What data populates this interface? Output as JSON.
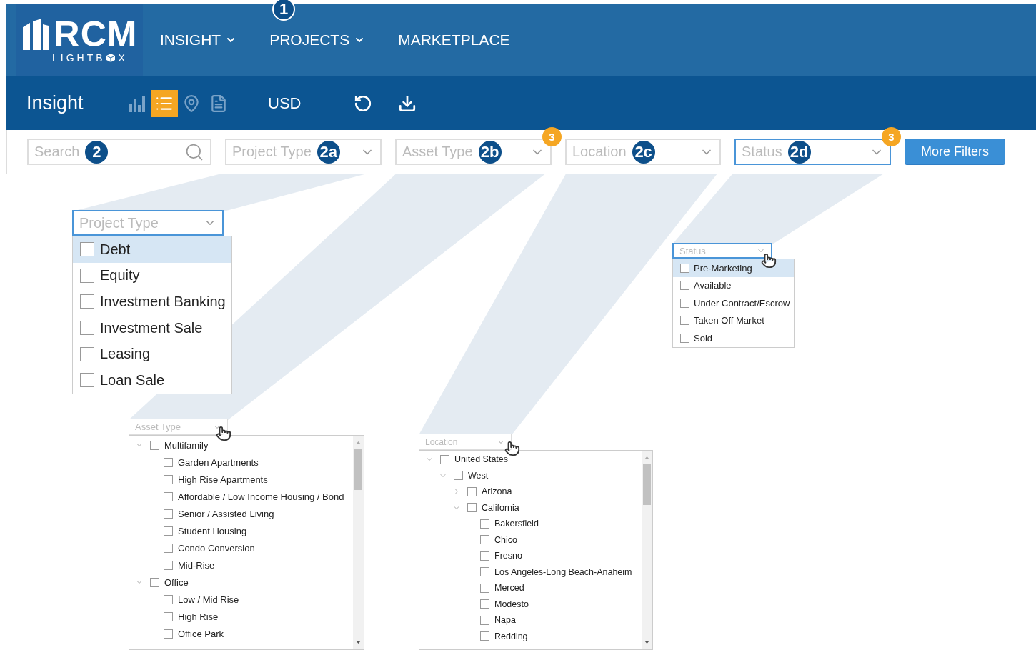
{
  "nav": {
    "logo_text": "RCM",
    "logo_sub_left": "LIGHTB",
    "logo_sub_right": "X",
    "annotation": "1",
    "items": [
      {
        "label": "INSIGHT",
        "dropdown": true
      },
      {
        "label": "PROJECTS",
        "dropdown": true
      },
      {
        "label": "MARKETPLACE",
        "dropdown": false
      }
    ]
  },
  "toolbar": {
    "title": "Insight",
    "currency": "USD",
    "views": [
      {
        "kind": "chart",
        "selected": false
      },
      {
        "kind": "list",
        "selected": true
      },
      {
        "kind": "map",
        "selected": false
      },
      {
        "kind": "document",
        "selected": false
      }
    ]
  },
  "filters": [
    {
      "kind": "search",
      "placeholder": "Search",
      "annotation": "2",
      "focused": false
    },
    {
      "kind": "select",
      "placeholder": "Project Type",
      "annotation": "2a",
      "focused": false
    },
    {
      "kind": "select",
      "placeholder": "Asset Type",
      "annotation": "2b",
      "focused": false,
      "count": "3"
    },
    {
      "kind": "select",
      "placeholder": "Location",
      "annotation": "2c",
      "focused": false
    },
    {
      "kind": "select",
      "placeholder": "Status",
      "annotation": "2d",
      "focused": true,
      "count": "3"
    }
  ],
  "more_filters": "More Filters",
  "project_type_dropdown": {
    "placeholder": "Project Type",
    "focused": true,
    "options": [
      {
        "label": "Debt",
        "checked": false,
        "hovered": true
      },
      {
        "label": "Equity",
        "checked": false,
        "hovered": false
      },
      {
        "label": "Investment Banking",
        "checked": false,
        "hovered": false
      },
      {
        "label": "Investment Sale",
        "checked": false,
        "hovered": false
      },
      {
        "label": "Leasing",
        "checked": false,
        "hovered": false
      },
      {
        "label": "Loan Sale",
        "checked": false,
        "hovered": false
      }
    ]
  },
  "status_dropdown": {
    "placeholder": "Status",
    "focused": true,
    "options": [
      {
        "label": "Pre-Marketing",
        "checked": false,
        "hovered": true
      },
      {
        "label": "Available",
        "checked": false,
        "hovered": false
      },
      {
        "label": "Under Contract/Escrow",
        "checked": false,
        "hovered": false
      },
      {
        "label": "Taken Off Market",
        "checked": false,
        "hovered": false
      },
      {
        "label": "Sold",
        "checked": false,
        "hovered": false
      }
    ]
  },
  "asset_type_dropdown": {
    "placeholder": "Asset Type",
    "focused": false,
    "tree": [
      {
        "label": "Multifamily",
        "checked": false,
        "expanded": true,
        "children": [
          {
            "label": "Garden Apartments",
            "checked": false
          },
          {
            "label": "High Rise Apartments",
            "checked": false
          },
          {
            "label": "Affordable / Low Income Housing / Bond",
            "checked": false
          },
          {
            "label": "Senior / Assisted Living",
            "checked": false
          },
          {
            "label": "Student Housing",
            "checked": false
          },
          {
            "label": "Condo Conversion",
            "checked": false
          },
          {
            "label": "Mid-Rise",
            "checked": false
          }
        ]
      },
      {
        "label": "Office",
        "checked": false,
        "expanded": true,
        "children": [
          {
            "label": "Low / Mid Rise",
            "checked": false
          },
          {
            "label": "High Rise",
            "checked": false
          },
          {
            "label": "Office Park",
            "checked": false
          }
        ]
      }
    ]
  },
  "location_dropdown": {
    "placeholder": "Location",
    "focused": false,
    "tree": [
      {
        "label": "United States",
        "checked": false,
        "expanded": true,
        "children": [
          {
            "label": "West",
            "checked": false,
            "expanded": true,
            "children": [
              {
                "label": "Arizona",
                "checked": false,
                "expanded": false
              },
              {
                "label": "California",
                "checked": false,
                "expanded": true,
                "children": [
                  {
                    "label": "Bakersfield",
                    "checked": false
                  },
                  {
                    "label": "Chico",
                    "checked": false
                  },
                  {
                    "label": "Fresno",
                    "checked": false
                  },
                  {
                    "label": "Los Angeles-Long Beach-Anaheim",
                    "checked": false
                  },
                  {
                    "label": "Merced",
                    "checked": false
                  },
                  {
                    "label": "Modesto",
                    "checked": false
                  },
                  {
                    "label": "Napa",
                    "checked": false
                  },
                  {
                    "label": "Redding",
                    "checked": false
                  }
                ]
              }
            ]
          }
        ]
      }
    ]
  }
}
